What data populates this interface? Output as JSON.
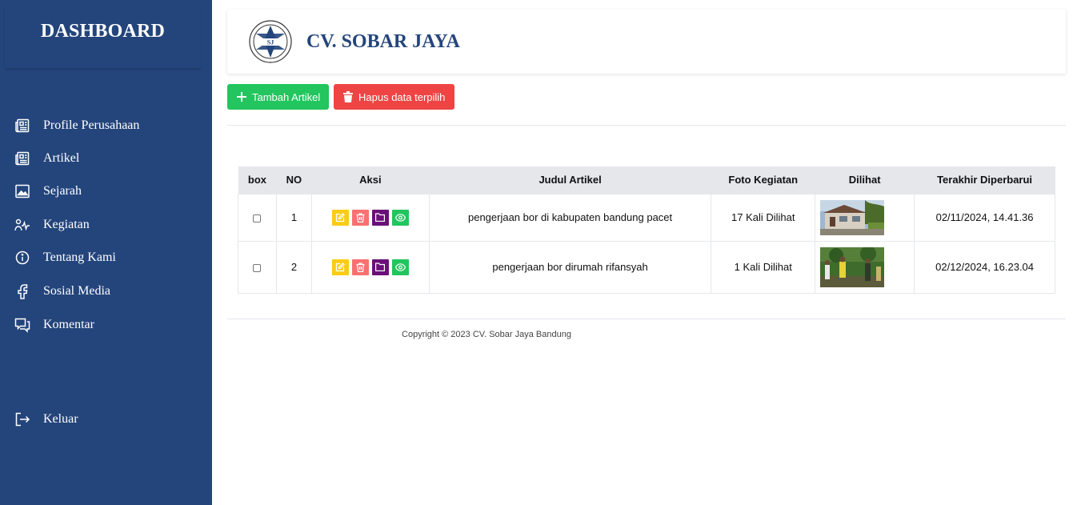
{
  "sidebar": {
    "brand": "DASHBOARD",
    "items": [
      {
        "label": "Profile Perusahaan",
        "icon": "newspaper-icon"
      },
      {
        "label": "Artikel",
        "icon": "newspaper-icon"
      },
      {
        "label": "Sejarah",
        "icon": "image-icon"
      },
      {
        "label": "Kegiatan",
        "icon": "activity-icon"
      },
      {
        "label": "Tentang Kami",
        "icon": "info-icon"
      },
      {
        "label": "Sosial Media",
        "icon": "facebook-icon"
      },
      {
        "label": "Komentar",
        "icon": "comment-icon"
      }
    ],
    "logout": {
      "label": "Keluar",
      "icon": "logout-icon"
    }
  },
  "header": {
    "company": "CV. SOBAR JAYA",
    "logo_text": "SJ"
  },
  "toolbar": {
    "add_label": "Tambah Artikel",
    "delete_label": "Hapus data terpilih"
  },
  "table": {
    "headers": [
      "box",
      "NO",
      "Aksi",
      "Judul Artikel",
      "Foto Kegiatan",
      "Dilihat",
      "Terakhir Diperbarui"
    ],
    "rows": [
      {
        "no": "1",
        "judul": "pengerjaan bor di kabupaten bandung pacet",
        "views": "17 Kali Dilihat",
        "updated": "02/11/2024, 14.41.36",
        "photo": "house-photo"
      },
      {
        "no": "2",
        "judul": "pengerjaan bor dirumah rifansyah",
        "views": "1 Kali Dilihat",
        "updated": "02/12/2024, 16.23.04",
        "photo": "workers-photo"
      }
    ]
  },
  "footer": {
    "copyright": "Copyright © 2023 CV. Sobar Jaya Bandung"
  },
  "colors": {
    "sidebar": "#24457b",
    "add": "#22c55e",
    "delete": "#ef4444",
    "edit": "#facc15",
    "trash": "#f87171",
    "folder": "#6b0f7a",
    "view": "#22c55e"
  }
}
